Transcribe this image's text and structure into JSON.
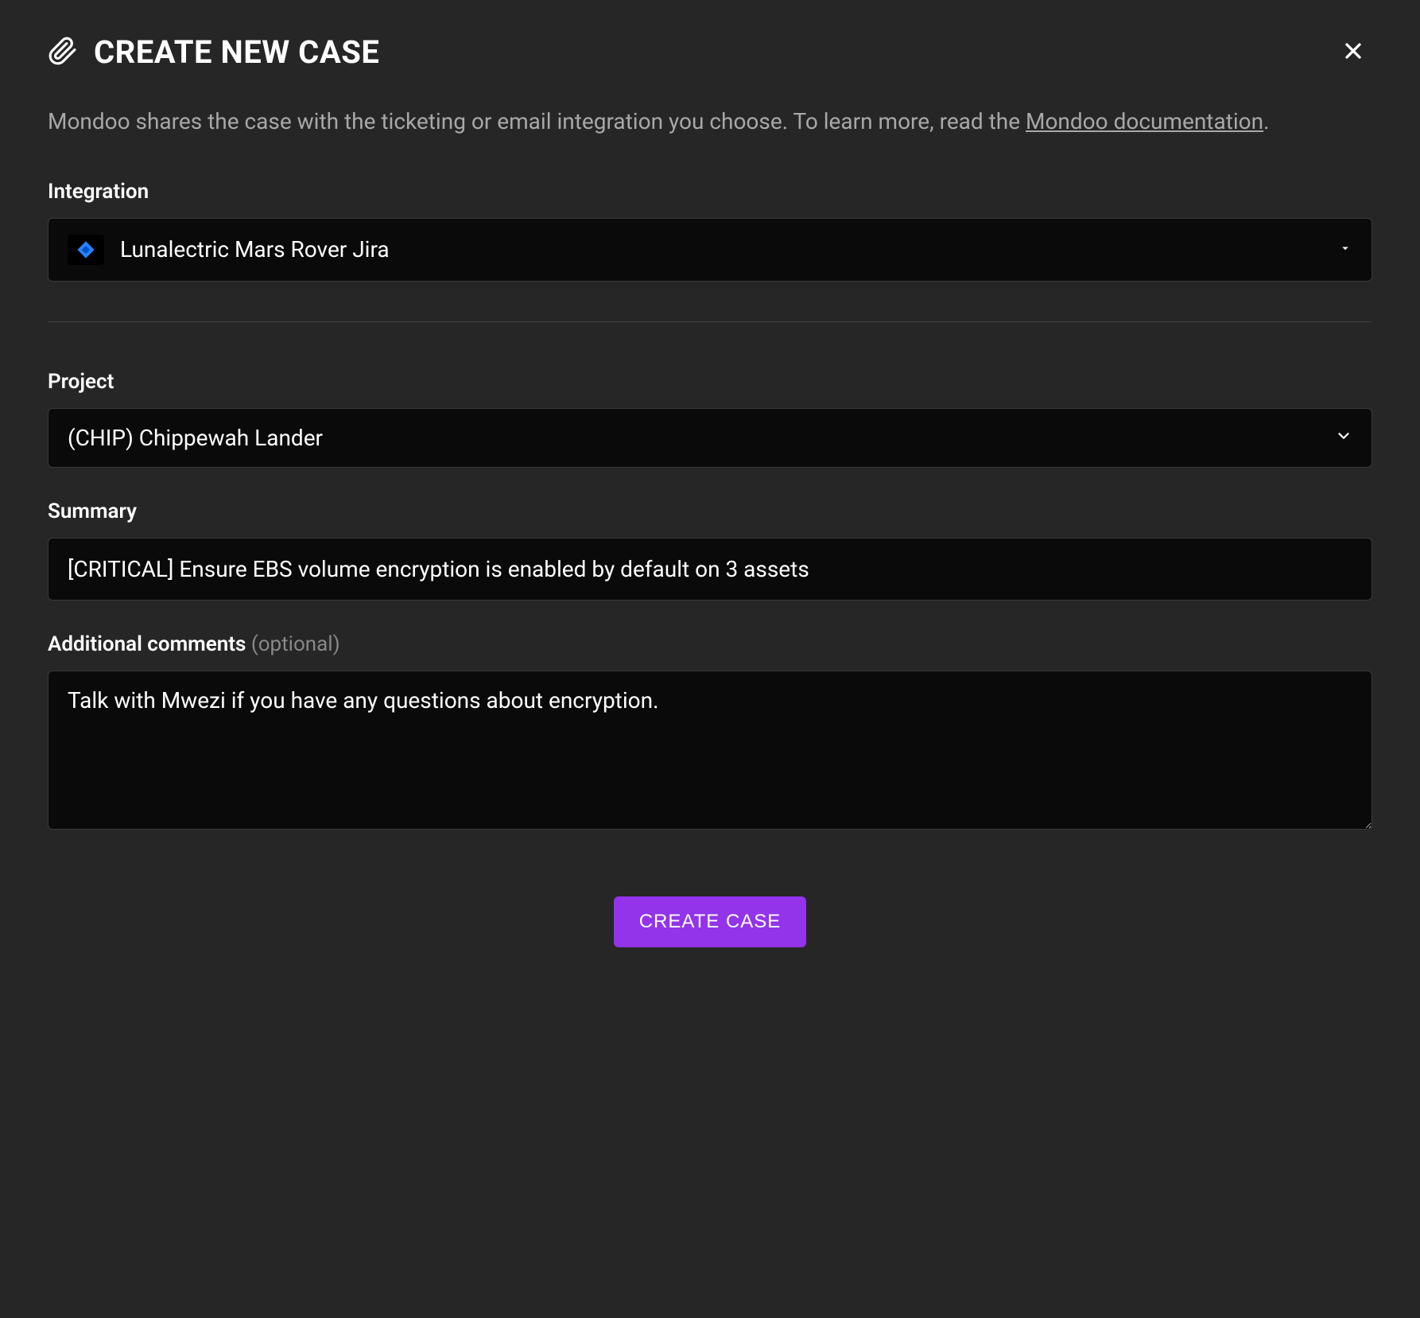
{
  "header": {
    "title": "CREATE NEW CASE"
  },
  "description": {
    "text_before_link": "Mondoo shares the case with the ticketing or email integration you choose. To learn more, read the ",
    "link_text": "Mondoo documentation",
    "text_after_link": "."
  },
  "form": {
    "integration": {
      "label": "Integration",
      "selected": "Lunalectric Mars Rover Jira"
    },
    "project": {
      "label": "Project",
      "selected": "(CHIP) Chippewah Lander"
    },
    "summary": {
      "label": "Summary",
      "value": "[CRITICAL] Ensure EBS volume encryption is enabled by default on 3 assets"
    },
    "comments": {
      "label": "Additional comments ",
      "optional_text": "(optional)",
      "value": "Talk with Mwezi if you have any questions about encryption."
    }
  },
  "button": {
    "create": "CREATE CASE"
  }
}
